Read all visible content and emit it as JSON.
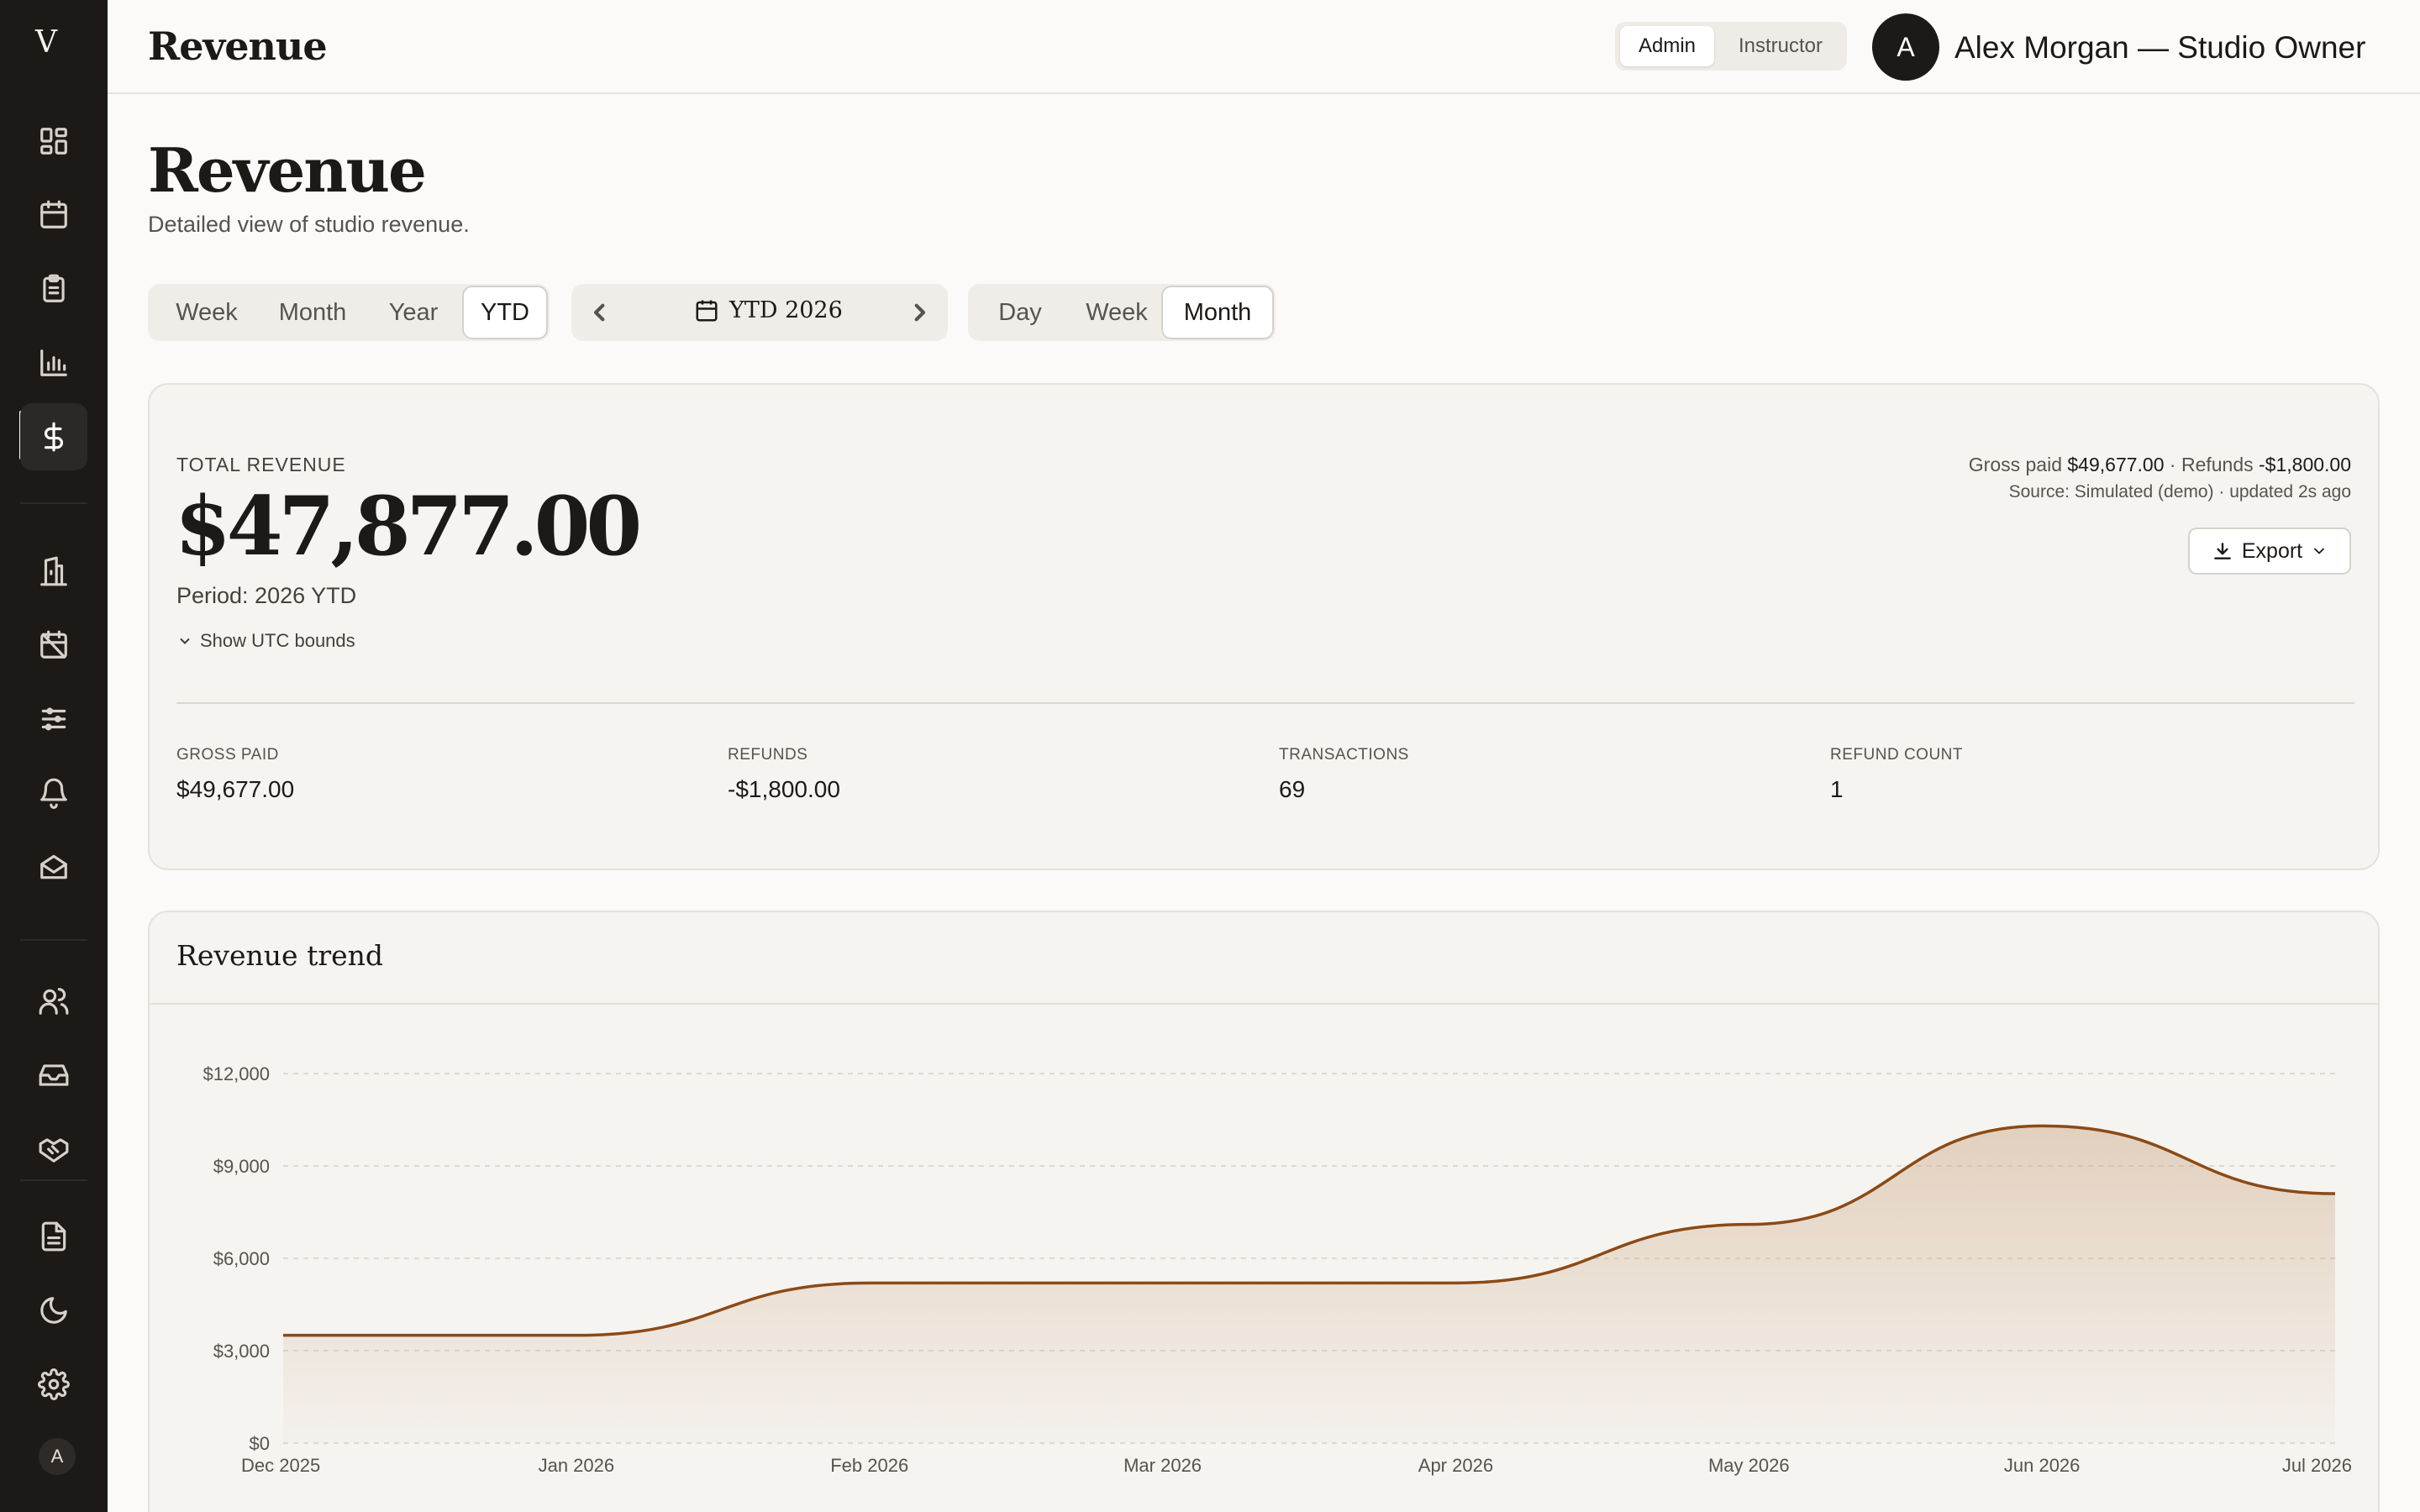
{
  "sidebar": {
    "logo": "V",
    "avatar": "A",
    "items": [
      {
        "icon": "dashboard-icon"
      },
      {
        "icon": "calendar-icon"
      },
      {
        "icon": "clipboard-icon"
      },
      {
        "icon": "bar-chart-icon"
      },
      {
        "icon": "dollar-icon",
        "active": true
      },
      {
        "icon": "building-icon"
      },
      {
        "icon": "calendar-off-icon"
      },
      {
        "icon": "sliders-icon"
      },
      {
        "icon": "bell-icon"
      },
      {
        "icon": "mail-open-icon"
      },
      {
        "icon": "users-icon"
      },
      {
        "icon": "inbox-icon"
      },
      {
        "icon": "handshake-icon"
      },
      {
        "icon": "file-text-icon"
      },
      {
        "icon": "moon-icon"
      },
      {
        "icon": "settings-icon"
      }
    ]
  },
  "topbar": {
    "title": "Revenue",
    "roles": [
      "Admin",
      "Instructor"
    ],
    "active_role": "Admin",
    "avatar_initial": "A",
    "user_name": "Alex Morgan — Studio Owner"
  },
  "page": {
    "title": "Revenue",
    "subtitle": "Detailed view of studio revenue."
  },
  "range_tabs": {
    "items": [
      "Week",
      "Month",
      "Year",
      "YTD"
    ],
    "active": "YTD"
  },
  "date_nav": {
    "label": "YTD 2026"
  },
  "granularity_tabs": {
    "items": [
      "Day",
      "Week",
      "Month"
    ],
    "active": "Month"
  },
  "summary": {
    "label": "TOTAL REVENUE",
    "total": "$47,877.00",
    "period": "Period: 2026 YTD",
    "utc_toggle": "Show UTC bounds",
    "gross_prefix": "Gross paid",
    "gross_value": "$49,677.00",
    "refunds_prefix": "· Refunds",
    "refunds_value": "-$1,800.00",
    "source": "Source: Simulated (demo) · updated 2s ago",
    "export_label": "Export",
    "stats": [
      {
        "label": "GROSS PAID",
        "value": "$49,677.00"
      },
      {
        "label": "REFUNDS",
        "value": "-$1,800.00"
      },
      {
        "label": "TRANSACTIONS",
        "value": "69"
      },
      {
        "label": "REFUND COUNT",
        "value": "1"
      }
    ]
  },
  "trend": {
    "title": "Revenue trend"
  },
  "chart_data": {
    "type": "area",
    "title": "Revenue trend",
    "x": [
      "Dec 2025",
      "Jan 2026",
      "Feb 2026",
      "Mar 2026",
      "Apr 2026",
      "May 2026",
      "Jun 2026",
      "Jul 2026"
    ],
    "series": [
      {
        "values": [
          3500,
          3500,
          5200,
          5200,
          5200,
          7100,
          10300,
          8100
        ]
      }
    ],
    "y_ticks": [
      "$0",
      "$3,000",
      "$6,000",
      "$9,000",
      "$12,000"
    ],
    "ylim": [
      0,
      12000
    ],
    "grid": true,
    "colors": {
      "line": "#8b4a16",
      "fill": "#c9a47f"
    }
  }
}
